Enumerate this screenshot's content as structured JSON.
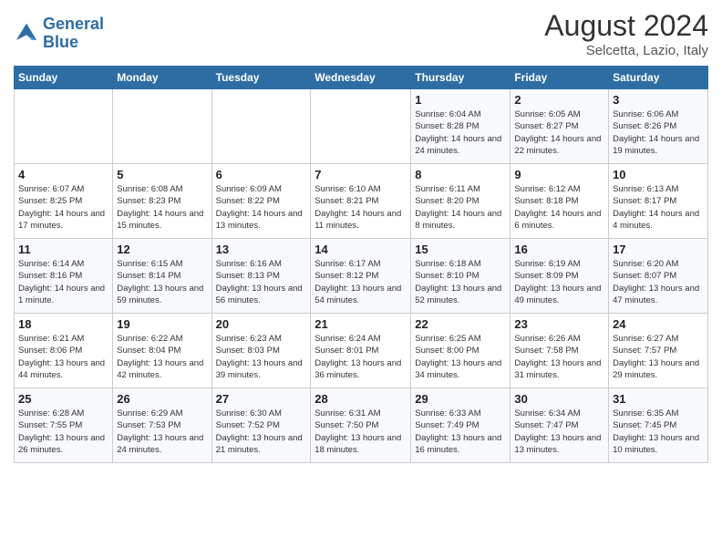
{
  "logo": {
    "line1": "General",
    "line2": "Blue"
  },
  "title": "August 2024",
  "subtitle": "Selcetta, Lazio, Italy",
  "days_of_week": [
    "Sunday",
    "Monday",
    "Tuesday",
    "Wednesday",
    "Thursday",
    "Friday",
    "Saturday"
  ],
  "weeks": [
    [
      {
        "day": "",
        "text": ""
      },
      {
        "day": "",
        "text": ""
      },
      {
        "day": "",
        "text": ""
      },
      {
        "day": "",
        "text": ""
      },
      {
        "day": "1",
        "text": "Sunrise: 6:04 AM\nSunset: 8:28 PM\nDaylight: 14 hours and 24 minutes."
      },
      {
        "day": "2",
        "text": "Sunrise: 6:05 AM\nSunset: 8:27 PM\nDaylight: 14 hours and 22 minutes."
      },
      {
        "day": "3",
        "text": "Sunrise: 6:06 AM\nSunset: 8:26 PM\nDaylight: 14 hours and 19 minutes."
      }
    ],
    [
      {
        "day": "4",
        "text": "Sunrise: 6:07 AM\nSunset: 8:25 PM\nDaylight: 14 hours and 17 minutes."
      },
      {
        "day": "5",
        "text": "Sunrise: 6:08 AM\nSunset: 8:23 PM\nDaylight: 14 hours and 15 minutes."
      },
      {
        "day": "6",
        "text": "Sunrise: 6:09 AM\nSunset: 8:22 PM\nDaylight: 14 hours and 13 minutes."
      },
      {
        "day": "7",
        "text": "Sunrise: 6:10 AM\nSunset: 8:21 PM\nDaylight: 14 hours and 11 minutes."
      },
      {
        "day": "8",
        "text": "Sunrise: 6:11 AM\nSunset: 8:20 PM\nDaylight: 14 hours and 8 minutes."
      },
      {
        "day": "9",
        "text": "Sunrise: 6:12 AM\nSunset: 8:18 PM\nDaylight: 14 hours and 6 minutes."
      },
      {
        "day": "10",
        "text": "Sunrise: 6:13 AM\nSunset: 8:17 PM\nDaylight: 14 hours and 4 minutes."
      }
    ],
    [
      {
        "day": "11",
        "text": "Sunrise: 6:14 AM\nSunset: 8:16 PM\nDaylight: 14 hours and 1 minute."
      },
      {
        "day": "12",
        "text": "Sunrise: 6:15 AM\nSunset: 8:14 PM\nDaylight: 13 hours and 59 minutes."
      },
      {
        "day": "13",
        "text": "Sunrise: 6:16 AM\nSunset: 8:13 PM\nDaylight: 13 hours and 56 minutes."
      },
      {
        "day": "14",
        "text": "Sunrise: 6:17 AM\nSunset: 8:12 PM\nDaylight: 13 hours and 54 minutes."
      },
      {
        "day": "15",
        "text": "Sunrise: 6:18 AM\nSunset: 8:10 PM\nDaylight: 13 hours and 52 minutes."
      },
      {
        "day": "16",
        "text": "Sunrise: 6:19 AM\nSunset: 8:09 PM\nDaylight: 13 hours and 49 minutes."
      },
      {
        "day": "17",
        "text": "Sunrise: 6:20 AM\nSunset: 8:07 PM\nDaylight: 13 hours and 47 minutes."
      }
    ],
    [
      {
        "day": "18",
        "text": "Sunrise: 6:21 AM\nSunset: 8:06 PM\nDaylight: 13 hours and 44 minutes."
      },
      {
        "day": "19",
        "text": "Sunrise: 6:22 AM\nSunset: 8:04 PM\nDaylight: 13 hours and 42 minutes."
      },
      {
        "day": "20",
        "text": "Sunrise: 6:23 AM\nSunset: 8:03 PM\nDaylight: 13 hours and 39 minutes."
      },
      {
        "day": "21",
        "text": "Sunrise: 6:24 AM\nSunset: 8:01 PM\nDaylight: 13 hours and 36 minutes."
      },
      {
        "day": "22",
        "text": "Sunrise: 6:25 AM\nSunset: 8:00 PM\nDaylight: 13 hours and 34 minutes."
      },
      {
        "day": "23",
        "text": "Sunrise: 6:26 AM\nSunset: 7:58 PM\nDaylight: 13 hours and 31 minutes."
      },
      {
        "day": "24",
        "text": "Sunrise: 6:27 AM\nSunset: 7:57 PM\nDaylight: 13 hours and 29 minutes."
      }
    ],
    [
      {
        "day": "25",
        "text": "Sunrise: 6:28 AM\nSunset: 7:55 PM\nDaylight: 13 hours and 26 minutes."
      },
      {
        "day": "26",
        "text": "Sunrise: 6:29 AM\nSunset: 7:53 PM\nDaylight: 13 hours and 24 minutes."
      },
      {
        "day": "27",
        "text": "Sunrise: 6:30 AM\nSunset: 7:52 PM\nDaylight: 13 hours and 21 minutes."
      },
      {
        "day": "28",
        "text": "Sunrise: 6:31 AM\nSunset: 7:50 PM\nDaylight: 13 hours and 18 minutes."
      },
      {
        "day": "29",
        "text": "Sunrise: 6:33 AM\nSunset: 7:49 PM\nDaylight: 13 hours and 16 minutes."
      },
      {
        "day": "30",
        "text": "Sunrise: 6:34 AM\nSunset: 7:47 PM\nDaylight: 13 hours and 13 minutes."
      },
      {
        "day": "31",
        "text": "Sunrise: 6:35 AM\nSunset: 7:45 PM\nDaylight: 13 hours and 10 minutes."
      }
    ]
  ]
}
